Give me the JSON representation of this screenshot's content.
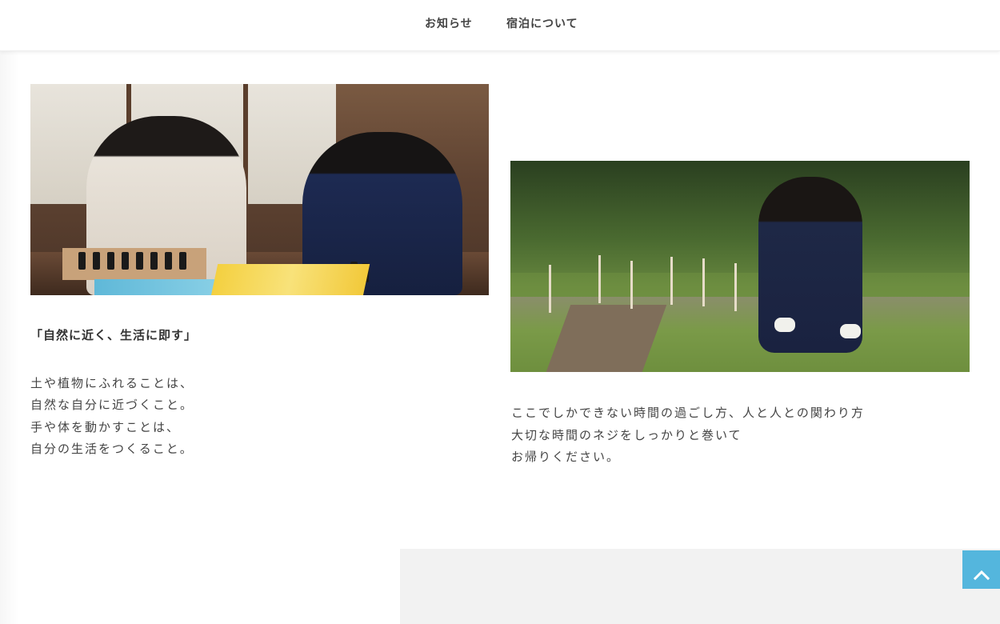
{
  "nav": {
    "items": [
      {
        "label": "お知らせ"
      },
      {
        "label": "宿泊について"
      }
    ]
  },
  "sections": {
    "left": {
      "heading": "「自然に近く、生活に即す」",
      "lines": [
        "土や植物にふれることは、",
        "自然な自分に近づくこと。",
        "手や体を動かすことは、",
        "自分の生活をつくること。"
      ]
    },
    "right": {
      "lines": [
        "ここでしかできない時間の過ごし方、人と人との関わり方",
        "大切な時間のネジをしっかりと巻いて",
        "お帰りください。"
      ]
    }
  },
  "back_to_top": {
    "icon": "chevron-up-icon"
  },
  "colors": {
    "accent": "#54b6dd",
    "text": "#333333",
    "panel": "#f2f2f2"
  }
}
